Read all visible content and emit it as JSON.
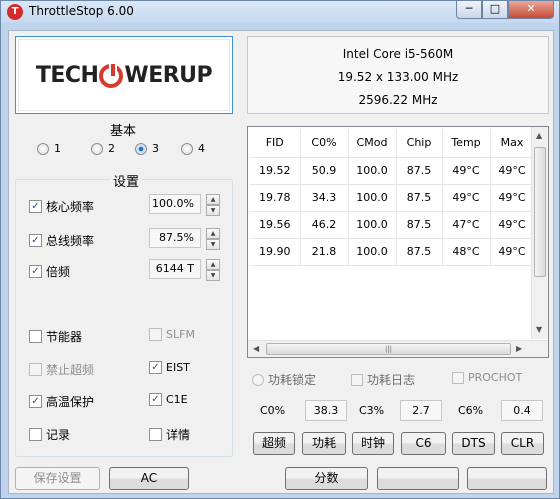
{
  "window": {
    "title": "ThrottleStop 6.00",
    "icon": "T",
    "min": "─",
    "max": "□",
    "close": "✕"
  },
  "logo": {
    "part1": "TECH",
    "part2": "WERUP"
  },
  "cpu": {
    "name": "Intel Core i5-560M",
    "multiplier": "19.52 x 133.00 MHz",
    "speed": "2596.22 MHz"
  },
  "basic": {
    "label": "基本",
    "options": [
      "1",
      "2",
      "3",
      "4"
    ],
    "selected": "3"
  },
  "settings": {
    "label": "设置",
    "core_label": "核心频率",
    "core_value": "100.0%",
    "bus_label": "总线频率",
    "bus_value": "87.5%",
    "mult_label": "倍频",
    "mult_value": "6144 T",
    "power_saver": "节能器",
    "slfm": "SLFM",
    "disable_turbo": "禁止超频",
    "eist": "EIST",
    "bd_prochot": "高温保护",
    "c1e": "C1E",
    "log": "记录",
    "more_data": "详情"
  },
  "table": {
    "headers": [
      "FID",
      "C0%",
      "CMod",
      "Chip",
      "Temp",
      "Max"
    ],
    "rows": [
      [
        "19.52",
        "50.9",
        "100.0",
        "87.5",
        "49°C",
        "49°C"
      ],
      [
        "19.78",
        "34.3",
        "100.0",
        "87.5",
        "49°C",
        "49°C"
      ],
      [
        "19.56",
        "46.2",
        "100.0",
        "87.5",
        "47°C",
        "49°C"
      ],
      [
        "19.90",
        "21.8",
        "100.0",
        "87.5",
        "48°C",
        "49°C"
      ]
    ]
  },
  "options": {
    "power_lock": "功耗锁定",
    "power_log": "功耗日志",
    "prochot": "PROCHOT"
  },
  "stats": {
    "c0_label": "C0%",
    "c0_value": "38.3",
    "c3_label": "C3%",
    "c3_value": "2.7",
    "c6_label": "C6%",
    "c6_value": "0.4"
  },
  "buttons": {
    "turbo": "超频",
    "power": "功耗",
    "clock": "时钟",
    "c6": "C6",
    "dts": "DTS",
    "clr": "CLR"
  },
  "bottom": {
    "save": "保存设置",
    "ac": "AC",
    "score": "分数",
    "fourth": "",
    "fifth": ""
  }
}
